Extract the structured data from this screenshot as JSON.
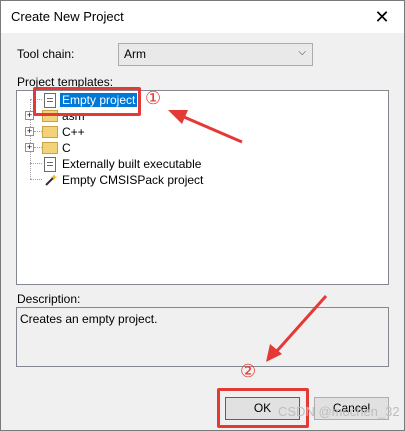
{
  "window": {
    "title": "Create New Project",
    "close_glyph": "✕"
  },
  "toolchain": {
    "label": "Tool chain:",
    "value": "Arm"
  },
  "templates": {
    "label": "Project templates:",
    "items": [
      {
        "label": "Empty project",
        "icon": "document-icon",
        "selected": true
      },
      {
        "label": "asm",
        "icon": "folder-icon",
        "expandable": true
      },
      {
        "label": "C++",
        "icon": "folder-icon",
        "expandable": true
      },
      {
        "label": "C",
        "icon": "folder-icon",
        "expandable": true
      },
      {
        "label": "Externally built executable",
        "icon": "document-icon"
      },
      {
        "label": "Empty CMSISPack project",
        "icon": "magic-wand-icon"
      }
    ]
  },
  "description": {
    "label": "Description:",
    "text": "Creates an empty project."
  },
  "buttons": {
    "ok": "OK",
    "cancel": "Cancel"
  },
  "annotations": {
    "marker1": "①",
    "marker2": "②",
    "color": "#e53935"
  },
  "watermark": "CSDN @mochen_32"
}
